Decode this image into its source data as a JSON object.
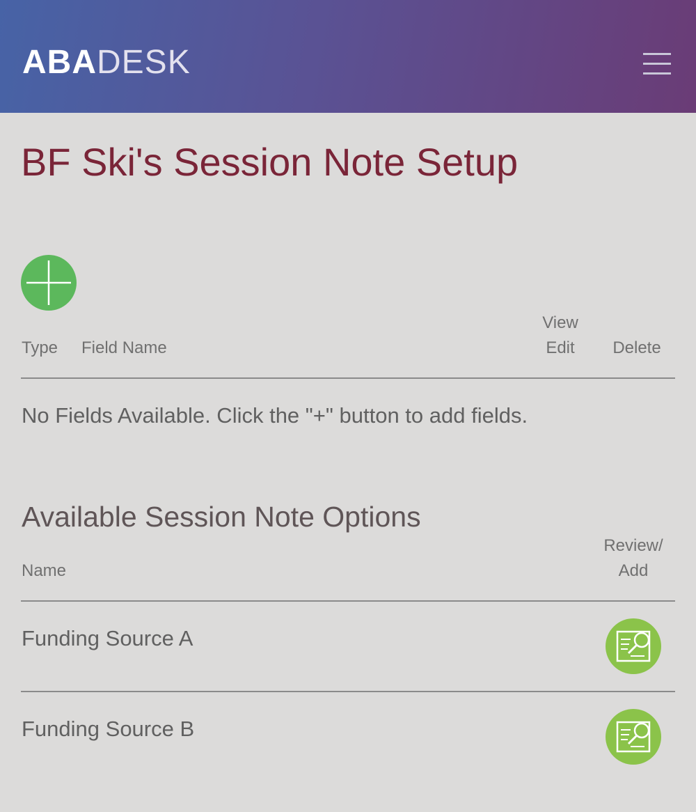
{
  "header": {
    "logo_bold": "ABA",
    "logo_light": "DESK",
    "menu_icon": "hamburger-menu-icon",
    "gradient_colors": [
      "#4763a6",
      "#6a3c76"
    ]
  },
  "page": {
    "title": "BF Ski's Session Note Setup",
    "title_color": "#7a2538"
  },
  "fields_section": {
    "add_icon": "plus-icon",
    "add_button_color": "#5cb85c",
    "columns": {
      "type": "Type",
      "field_name": "Field Name",
      "view": "View",
      "edit": "Edit",
      "delete": "Delete"
    },
    "empty_message": "No Fields Available. Click the \"+\" button to add fields."
  },
  "options_section": {
    "title": "Available Session Note Options",
    "columns": {
      "name": "Name",
      "review": "Review/",
      "add": "Add"
    },
    "action_icon": "document-search-icon",
    "action_color": "#8bc34a",
    "rows": [
      {
        "name": "Funding Source A"
      },
      {
        "name": "Funding Source B"
      }
    ]
  }
}
